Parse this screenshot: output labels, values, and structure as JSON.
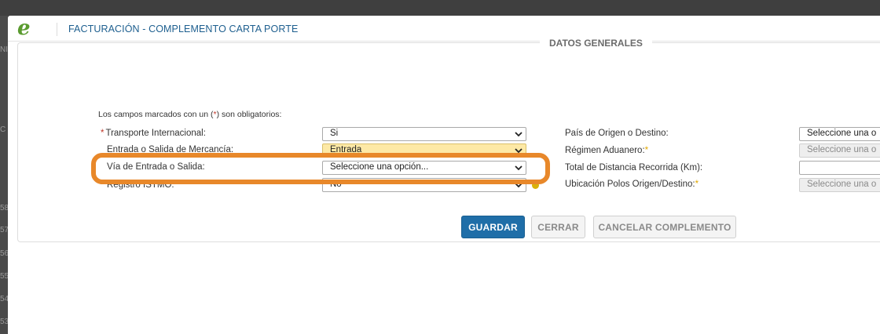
{
  "modal": {
    "logo": "e",
    "title": "FACTURACIÓN - COMPLEMENTO CARTA PORTE"
  },
  "backdrop_fragments": [
    "NI",
    "C",
    "58",
    "57",
    "56",
    "55",
    "54",
    "53"
  ],
  "section": {
    "legend": "DATOS GENERALES"
  },
  "form_note": {
    "prefix": "Los campos marcados con un (",
    "asterisk": "*",
    "suffix": ") son obligatorios:"
  },
  "left_fields": [
    {
      "label": "Transporte Internacional:",
      "required": "*",
      "value": "Si"
    },
    {
      "label": "Entrada o Salida de Mercancía:",
      "value": "Entrada"
    },
    {
      "label": "Vía de Entrada o Salida:",
      "value": "Seleccione una opción..."
    },
    {
      "label": "Registro ISTMO:",
      "value": "No"
    }
  ],
  "right_fields": [
    {
      "label": "País de Origen o Destino:",
      "value": "Seleccione una o"
    },
    {
      "label": "Régimen Aduanero:",
      "required": "*",
      "value": "Seleccione una o"
    },
    {
      "label": "Total de Distancia Recorrida (Km):",
      "value": ""
    },
    {
      "label": "Ubicación Polos Origen/Destino:",
      "required": "*",
      "value": "Seleccione una o"
    }
  ],
  "buttons": {
    "save": "GUARDAR",
    "close": "CERRAR",
    "cancel": "CANCELAR COMPLEMENTO"
  },
  "colors": {
    "primary": "#1f6ea8",
    "title_blue": "#1e5f8f",
    "highlight": "#e8882a",
    "required_red": "#c0392b",
    "required_yellow": "#e2a800"
  }
}
